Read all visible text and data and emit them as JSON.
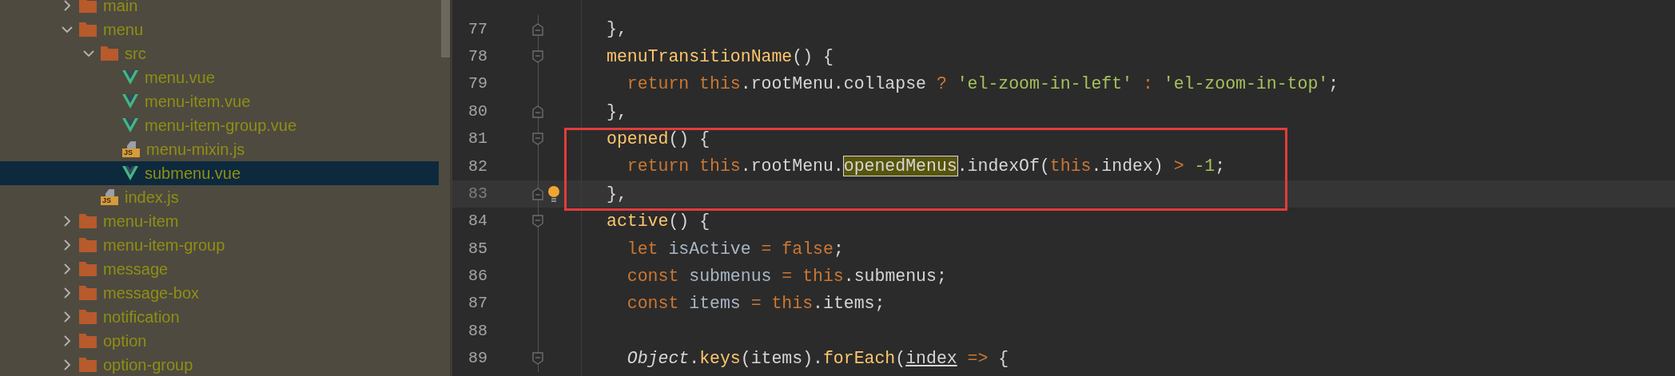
{
  "project_tree": {
    "items": [
      {
        "label": "main",
        "kind": "folder",
        "expanded": false,
        "selected": false
      },
      {
        "label": "menu",
        "kind": "folder",
        "expanded": true,
        "selected": false,
        "children": [
          {
            "label": "src",
            "kind": "folder",
            "expanded": true,
            "selected": false,
            "children": [
              {
                "label": "menu.vue",
                "kind": "vue",
                "selected": false
              },
              {
                "label": "menu-item.vue",
                "kind": "vue",
                "selected": false
              },
              {
                "label": "menu-item-group.vue",
                "kind": "vue",
                "selected": false
              },
              {
                "label": "menu-mixin.js",
                "kind": "js",
                "icon_label": "JS",
                "selected": false
              },
              {
                "label": "submenu.vue",
                "kind": "vue",
                "selected": true
              }
            ]
          },
          {
            "label": "index.js",
            "kind": "js",
            "icon_label": "JS",
            "selected": false
          }
        ]
      },
      {
        "label": "menu-item",
        "kind": "folder",
        "expanded": false,
        "selected": false
      },
      {
        "label": "menu-item-group",
        "kind": "folder",
        "expanded": false,
        "selected": false
      },
      {
        "label": "message",
        "kind": "folder",
        "expanded": false,
        "selected": false
      },
      {
        "label": "message-box",
        "kind": "folder",
        "expanded": false,
        "selected": false
      },
      {
        "label": "notification",
        "kind": "folder",
        "expanded": false,
        "selected": false
      },
      {
        "label": "option",
        "kind": "folder",
        "expanded": false,
        "selected": false
      },
      {
        "label": "option-group",
        "kind": "folder",
        "expanded": false,
        "selected": false
      }
    ]
  },
  "editor": {
    "lines": [
      {
        "number": "77",
        "current": false,
        "boxed": false,
        "fold_end": true,
        "tokens": [
          {
            "text": "},",
            "kind": "plain"
          }
        ]
      },
      {
        "number": "78",
        "current": false,
        "boxed": false,
        "fold_start": true,
        "tokens": [
          {
            "text": "menuTransitionName",
            "kind": "function"
          },
          {
            "text": "() {",
            "kind": "plain"
          }
        ]
      },
      {
        "number": "79",
        "current": false,
        "boxed": false,
        "tokens": [
          {
            "text": "  return",
            "kind": "keyword"
          },
          {
            "text": " this",
            "kind": "keyword"
          },
          {
            "text": ".rootMenu.collapse ",
            "kind": "plain"
          },
          {
            "text": "? ",
            "kind": "operator"
          },
          {
            "text": "'el-zoom-in-left' ",
            "kind": "string"
          },
          {
            "text": ": ",
            "kind": "operator"
          },
          {
            "text": "'el-zoom-in-top'",
            "kind": "string"
          },
          {
            "text": ";",
            "kind": "plain"
          }
        ]
      },
      {
        "number": "80",
        "current": false,
        "boxed": false,
        "fold_end": true,
        "tokens": [
          {
            "text": "},",
            "kind": "plain"
          }
        ]
      },
      {
        "number": "81",
        "current": false,
        "boxed": true,
        "fold_start": true,
        "tokens": [
          {
            "text": "opened",
            "kind": "function"
          },
          {
            "text": "() {",
            "kind": "plain"
          }
        ]
      },
      {
        "number": "82",
        "current": false,
        "boxed": true,
        "tokens": [
          {
            "text": "  return",
            "kind": "keyword"
          },
          {
            "text": " this",
            "kind": "keyword"
          },
          {
            "text": ".rootMenu.",
            "kind": "plain"
          },
          {
            "text": "openedMenus",
            "kind": "match"
          },
          {
            "text": ".indexOf(",
            "kind": "plain"
          },
          {
            "text": "this",
            "kind": "keyword"
          },
          {
            "text": ".index) ",
            "kind": "plain"
          },
          {
            "text": "> ",
            "kind": "operator"
          },
          {
            "text": "-1",
            "kind": "number"
          },
          {
            "text": ";",
            "kind": "plain"
          }
        ]
      },
      {
        "number": "83",
        "current": true,
        "boxed": true,
        "fold_end": true,
        "bulb": true,
        "tokens": [
          {
            "text": "},",
            "kind": "plain"
          }
        ]
      },
      {
        "number": "84",
        "current": false,
        "boxed": false,
        "fold_start": true,
        "tokens": [
          {
            "text": "active",
            "kind": "function"
          },
          {
            "text": "() {",
            "kind": "plain"
          }
        ]
      },
      {
        "number": "85",
        "current": false,
        "boxed": false,
        "tokens": [
          {
            "text": "  let",
            "kind": "keyword"
          },
          {
            "text": " isActive ",
            "kind": "variable"
          },
          {
            "text": "= false",
            "kind": "keyword"
          },
          {
            "text": ";",
            "kind": "plain"
          }
        ]
      },
      {
        "number": "86",
        "current": false,
        "boxed": false,
        "tokens": [
          {
            "text": "  const",
            "kind": "keyword"
          },
          {
            "text": " submenus ",
            "kind": "variable"
          },
          {
            "text": "= this",
            "kind": "keyword"
          },
          {
            "text": ".submenus;",
            "kind": "plain"
          }
        ]
      },
      {
        "number": "87",
        "current": false,
        "boxed": false,
        "tokens": [
          {
            "text": "  const",
            "kind": "keyword"
          },
          {
            "text": " items ",
            "kind": "variable"
          },
          {
            "text": "= this",
            "kind": "keyword"
          },
          {
            "text": ".items;",
            "kind": "plain"
          }
        ]
      },
      {
        "number": "88",
        "current": false,
        "boxed": false
      },
      {
        "number": "89",
        "current": false,
        "boxed": false,
        "fold_start": true,
        "tokens": [
          {
            "text": "  Object",
            "kind": "class"
          },
          {
            "text": ".",
            "kind": "plain"
          },
          {
            "text": "keys",
            "kind": "function"
          },
          {
            "text": "(items).",
            "kind": "plain"
          },
          {
            "text": "forEach",
            "kind": "function"
          },
          {
            "text": "(",
            "kind": "plain"
          },
          {
            "text": "index",
            "kind": "parameter"
          },
          {
            "text": " => ",
            "kind": "operator"
          },
          {
            "text": "{",
            "kind": "plain"
          }
        ]
      }
    ]
  }
}
